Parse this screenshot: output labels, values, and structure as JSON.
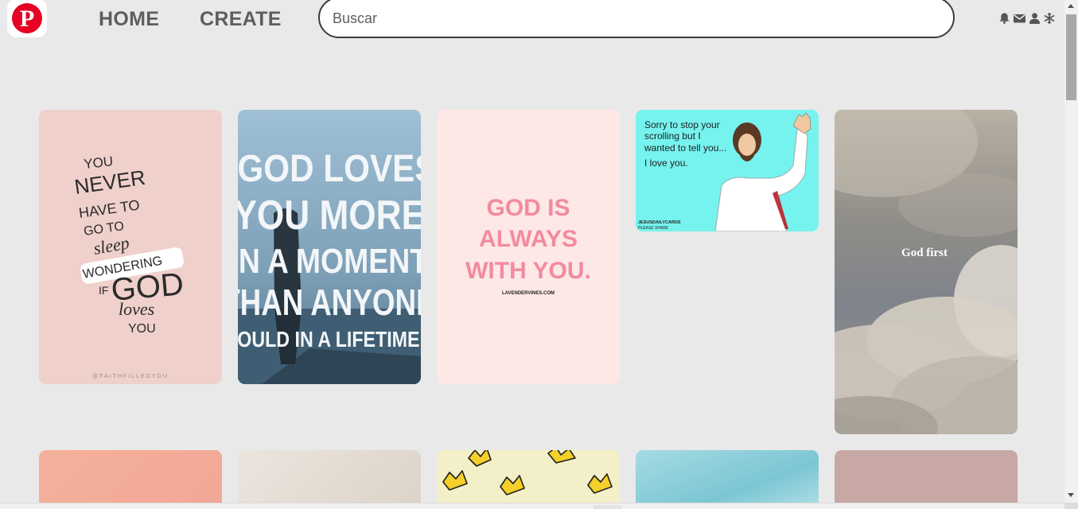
{
  "header": {
    "logo_letter": "P",
    "nav": {
      "home": "HOME",
      "create": "CREATE"
    },
    "search": {
      "placeholder": "Buscar",
      "value": ""
    },
    "icons": [
      "bell-icon",
      "mail-icon",
      "user-icon",
      "snowflake-icon"
    ]
  },
  "pins": [
    {
      "name": "You never have to go to sleep wondering if God loves you",
      "lines": [
        "YOU",
        "NEVER",
        "HAVE TO",
        "GO TO",
        "sleep",
        "WONDERING",
        "IF",
        "GOD",
        "loves",
        "YOU"
      ],
      "footer": "@FAITHFILLEDYOU"
    },
    {
      "name": "God loves you more in a moment than anyone could in a lifetime",
      "lines": [
        "“GOD LOVES",
        "YOU MORE",
        "IN A MOMENT",
        "THAN ANYONE",
        "COULD IN A LIFETIME.”"
      ]
    },
    {
      "name": "God is always with you",
      "lines": [
        "GOD IS",
        "ALWAYS",
        "WITH YOU."
      ],
      "footer": "LAVENDERVINES.COM"
    },
    {
      "name": "Sorry to stop your scrolling",
      "lines": [
        "Sorry to stop your",
        "scrolling but I",
        "wanted to tell you...",
        "I love you."
      ],
      "brand": "JESUSDAILYCARDS",
      "brand_sub": "PLEASE SHARE"
    },
    {
      "name": "God first",
      "lines": [
        "God first"
      ]
    }
  ],
  "colors": {
    "background": "#e9e9e9",
    "brand_red": "#e60023",
    "nav_text": "#5e5e5e",
    "pink_text": "#f38aa0"
  }
}
